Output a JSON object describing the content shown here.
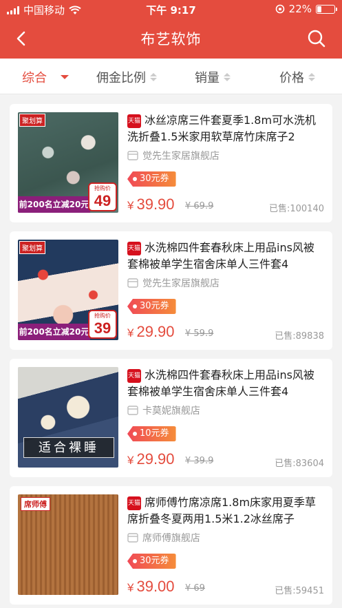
{
  "status_bar": {
    "carrier": "中国移动",
    "time": "下午 9:17",
    "battery_pct": "22%"
  },
  "nav": {
    "title": "布艺软饰"
  },
  "sort": {
    "items": [
      "综合",
      "佣金比例",
      "销量",
      "价格"
    ],
    "active_index": 0
  },
  "products": [
    {
      "badge": "天猫",
      "title": "冰丝凉席三件套夏季1.8m可水洗机洗折叠1.5米家用软草席竹床席子2",
      "shop": "觉先生家居旗舰店",
      "coupon": "30元券",
      "currency": "¥",
      "price": "39.90",
      "original_price": "¥ 69.9",
      "sold": "已售:100140",
      "image": {
        "tag": "聚划算",
        "bar_text": "前200名立减20元",
        "price_label": "抢购价",
        "price_num": "49"
      }
    },
    {
      "badge": "天猫",
      "title": "水洗棉四件套春秋床上用品ins风被套棉被单学生宿舍床单人三件套4",
      "shop": "觉先生家居旗舰店",
      "coupon": "30元券",
      "currency": "¥",
      "price": "29.90",
      "original_price": "¥ 59.9",
      "sold": "已售:89838",
      "image": {
        "tag": "聚划算",
        "bar_text": "前200名立减20元",
        "price_label": "抢购价",
        "price_num": "39"
      }
    },
    {
      "badge": "天猫",
      "title": "水洗棉四件套春秋床上用品ins风被套棉被单学生宿舍床单人三件套4",
      "shop": "卡莫妮旗舰店",
      "coupon": "10元券",
      "currency": "¥",
      "price": "29.90",
      "original_price": "¥ 39.9",
      "sold": "已售:83604",
      "image": {
        "caption": "适合裸睡"
      }
    },
    {
      "badge": "天猫",
      "title": "席师傅竹席凉席1.8m床家用夏季草席折叠冬夏两用1.5米1.2冰丝席子",
      "shop": "席师傅旗舰店",
      "coupon": "30元券",
      "currency": "¥",
      "price": "39.00",
      "original_price": "¥ 69",
      "sold": "已售:59451",
      "image": {
        "brand": "席师傅"
      }
    }
  ],
  "colors": {
    "brand_red": "#e44c3e",
    "tmall_red": "#d6101d"
  }
}
